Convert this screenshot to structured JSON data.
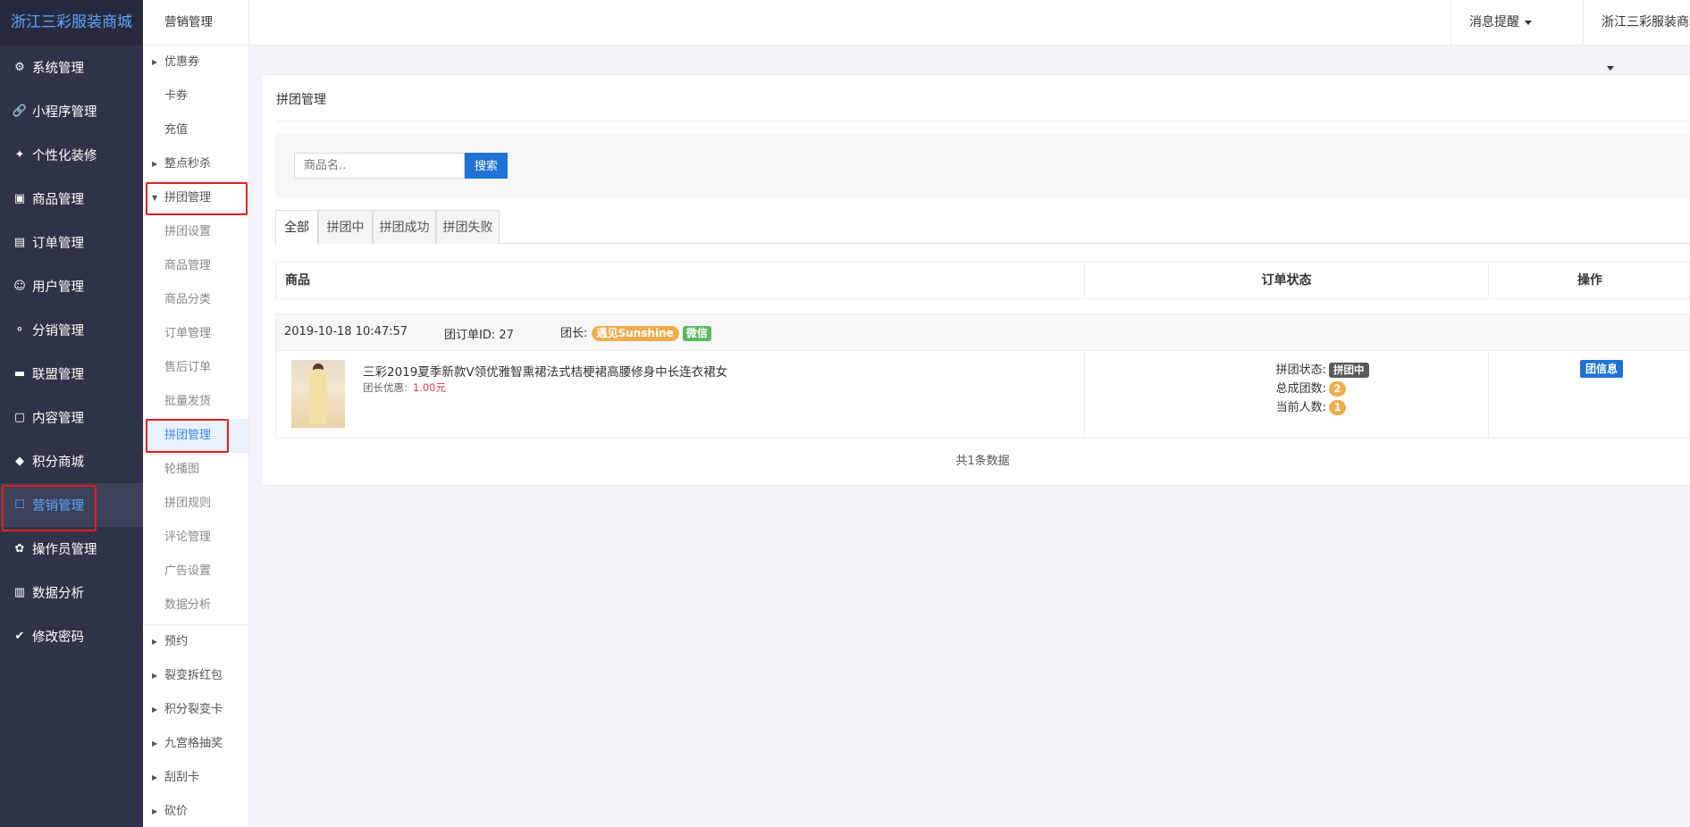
{
  "brand": "浙江三彩服装商城",
  "nav": [
    {
      "label": "系统管理",
      "icon": "gear-icon",
      "glyph": "⚙"
    },
    {
      "label": "小程序管理",
      "icon": "link-icon",
      "glyph": "🔗"
    },
    {
      "label": "个性化装修",
      "icon": "paint-icon",
      "glyph": "✦"
    },
    {
      "label": "商品管理",
      "icon": "bag-icon",
      "glyph": "▣"
    },
    {
      "label": "订单管理",
      "icon": "order-icon",
      "glyph": "▤"
    },
    {
      "label": "用户管理",
      "icon": "user-icon",
      "glyph": "☺"
    },
    {
      "label": "分销管理",
      "icon": "sitemap-icon",
      "glyph": "⚬"
    },
    {
      "label": "联盟管理",
      "icon": "store-icon",
      "glyph": "▬"
    },
    {
      "label": "内容管理",
      "icon": "content-icon",
      "glyph": "▢"
    },
    {
      "label": "积分商城",
      "icon": "cube-icon",
      "glyph": "◆"
    },
    {
      "label": "营销管理",
      "icon": "marketing-icon",
      "glyph": "☐"
    },
    {
      "label": "操作员管理",
      "icon": "cog-icon",
      "glyph": "✿"
    },
    {
      "label": "数据分析",
      "icon": "chart-icon",
      "glyph": "▥"
    },
    {
      "label": "修改密码",
      "icon": "shield-icon",
      "glyph": "✔"
    }
  ],
  "subnav": {
    "title": "营销管理",
    "items": [
      {
        "label": "优惠券",
        "type": "group"
      },
      {
        "label": "卡券",
        "type": "plain"
      },
      {
        "label": "充值",
        "type": "plain"
      },
      {
        "label": "整点秒杀",
        "type": "group"
      },
      {
        "label": "拼团管理",
        "type": "open"
      },
      {
        "label": "拼团设置",
        "type": "child"
      },
      {
        "label": "商品管理",
        "type": "child"
      },
      {
        "label": "商品分类",
        "type": "child"
      },
      {
        "label": "订单管理",
        "type": "child"
      },
      {
        "label": "售后订单",
        "type": "child"
      },
      {
        "label": "批量发货",
        "type": "child"
      },
      {
        "label": "拼团管理",
        "type": "selected"
      },
      {
        "label": "轮播图",
        "type": "child"
      },
      {
        "label": "拼团规则",
        "type": "child"
      },
      {
        "label": "评论管理",
        "type": "child"
      },
      {
        "label": "广告设置",
        "type": "child"
      },
      {
        "label": "数据分析",
        "type": "child"
      },
      {
        "label": "预约",
        "type": "group"
      },
      {
        "label": "裂变拆红包",
        "type": "group"
      },
      {
        "label": "积分裂变卡",
        "type": "group"
      },
      {
        "label": "九宫格抽奖",
        "type": "group"
      },
      {
        "label": "刮刮卡",
        "type": "group"
      },
      {
        "label": "砍价",
        "type": "group"
      }
    ]
  },
  "header": {
    "messages": "消息提醒",
    "store": "浙江三彩服装商城"
  },
  "page": {
    "title": "拼团管理",
    "search_placeholder": "商品名..",
    "search_button": "搜索",
    "tabs": [
      "全部",
      "拼团中",
      "拼团成功",
      "拼团失败"
    ],
    "columns": [
      "商品",
      "订单状态",
      "操作"
    ]
  },
  "group": {
    "datetime": "2019-10-18 10:47:57",
    "order_id_label": "团订单ID:",
    "order_id": "27",
    "leader_label": "团长:",
    "leader_name": "遇见Sunshine",
    "leader_source": "微信"
  },
  "item": {
    "name": "三彩2019夏季新款V领优雅智熏裙法式桔梗裙高腰修身中长连衣裙女",
    "discount_label": "团长优惠:",
    "discount_value": "1.00元",
    "status_label": "拼团状态:",
    "status_value": "拼团中",
    "total_groups_label": "总成团数:",
    "total_groups": "2",
    "current_people_label": "当前人数:",
    "current_people": "1",
    "action": "团信息"
  },
  "footer": {
    "total": "共1条数据"
  }
}
